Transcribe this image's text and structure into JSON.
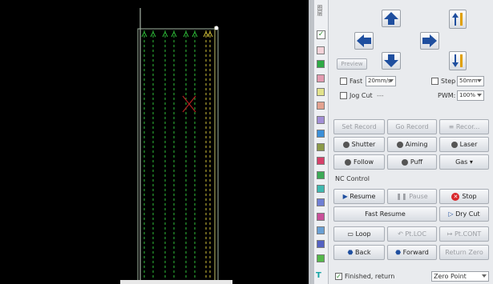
{
  "colors": {
    "canvas_bg": "#000000",
    "path_green": "#2fbf3a",
    "path_yellow": "#d4c23a",
    "frame": "#b8c8b8",
    "marker_red": "#cc2222",
    "accent_blue": "#1f4f9f",
    "stop_red": "#d8262a"
  },
  "jog": {
    "preview_label": "Preview"
  },
  "fast": {
    "label": "Fast",
    "speed_value": "20mm/s"
  },
  "step": {
    "label": "Step",
    "value": "50mm"
  },
  "jog_cut": {
    "label": "Jog Cut",
    "suffix": "---"
  },
  "pwm": {
    "label": "PWM:",
    "value": "100%"
  },
  "record": {
    "set_label": "Set Record",
    "go_label": "Go Record",
    "menu_label": "Recor..."
  },
  "toggles": {
    "shutter": "Shutter",
    "aiming": "Aiming",
    "laser": "Laser",
    "follow": "Follow",
    "puff": "Puff",
    "gas": "Gas"
  },
  "nc": {
    "title": "NC Control",
    "resume": "Resume",
    "pause": "Pause",
    "stop": "Stop",
    "fast_resume": "Fast Resume",
    "dry_cut": "Dry Cut",
    "loop": "Loop",
    "pt_loc": "Pt.LOC",
    "pt_cont": "Pt.CONT",
    "back": "Back",
    "forward": "Forward",
    "return_zero": "Return Zero"
  },
  "footer": {
    "finished_label": "Finished, return",
    "zero_point": "Zero Point"
  },
  "palette_colors": [
    "#f4d3d9",
    "#2eaa45",
    "#e39bb0",
    "#e2e28b",
    "#e3a28f",
    "#a38fd6",
    "#3b8fd8",
    "#8c9b4a",
    "#d6406a",
    "#3caa56",
    "#40b9b0",
    "#6f7fd4",
    "#c9509a",
    "#6aa0d4",
    "#5462c2",
    "#55b84b"
  ]
}
